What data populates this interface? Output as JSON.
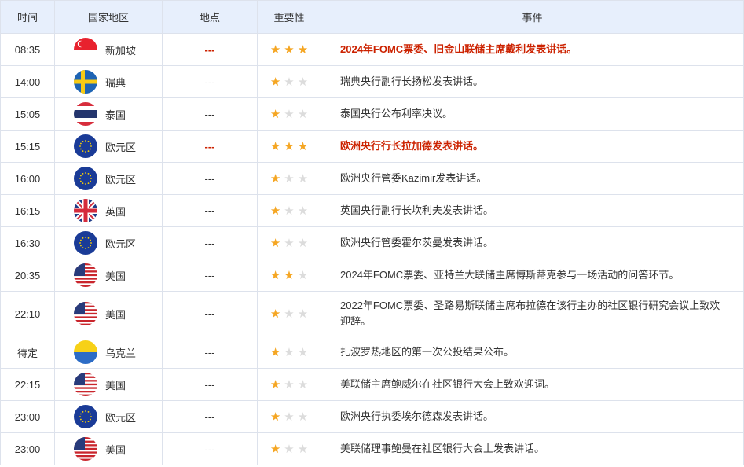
{
  "header": {
    "time": "时间",
    "country": "国家地区",
    "location": "地点",
    "importance": "重要性",
    "event": "事件"
  },
  "colors": {
    "high_importance_text": "#cc2200",
    "star_on": "#f5a623",
    "star_off": "#dcdcdc",
    "header_bg": "#e7effc"
  },
  "rows": [
    {
      "time": "08:35",
      "flag": "singapore-flag-icon",
      "country": "新加坡",
      "location": "---",
      "stars": 3,
      "event": "2024年FOMC票委、旧金山联储主席戴利发表讲话。"
    },
    {
      "time": "14:00",
      "flag": "sweden-flag-icon",
      "country": "瑞典",
      "location": "---",
      "stars": 1,
      "event": "瑞典央行副行长扬松发表讲话。"
    },
    {
      "time": "15:05",
      "flag": "thailand-flag-icon",
      "country": "泰国",
      "location": "---",
      "stars": 1,
      "event": "泰国央行公布利率决议。"
    },
    {
      "time": "15:15",
      "flag": "eu-flag-icon",
      "country": "欧元区",
      "location": "---",
      "stars": 3,
      "event": "欧洲央行行长拉加德发表讲话。"
    },
    {
      "time": "16:00",
      "flag": "eu-flag-icon",
      "country": "欧元区",
      "location": "---",
      "stars": 1,
      "event": "欧洲央行管委Kazimir发表讲话。"
    },
    {
      "time": "16:15",
      "flag": "uk-flag-icon",
      "country": "英国",
      "location": "---",
      "stars": 1,
      "event": "英国央行副行长坎利夫发表讲话。"
    },
    {
      "time": "16:30",
      "flag": "eu-flag-icon",
      "country": "欧元区",
      "location": "---",
      "stars": 1,
      "event": "欧洲央行管委霍尔茨曼发表讲话。"
    },
    {
      "time": "20:35",
      "flag": "usa-flag-icon",
      "country": "美国",
      "location": "---",
      "stars": 2,
      "event": "2024年FOMC票委、亚特兰大联储主席博斯蒂克参与一场活动的问答环节。"
    },
    {
      "time": "22:10",
      "flag": "usa-flag-icon",
      "country": "美国",
      "location": "---",
      "stars": 1,
      "event": "2022年FOMC票委、圣路易斯联储主席布拉德在该行主办的社区银行研究会议上致欢迎辞。"
    },
    {
      "time": "待定",
      "flag": "ukraine-flag-icon",
      "country": "乌克兰",
      "location": "---",
      "stars": 1,
      "event": "扎波罗热地区的第一次公投结果公布。"
    },
    {
      "time": "22:15",
      "flag": "usa-flag-icon",
      "country": "美国",
      "location": "---",
      "stars": 1,
      "event": "美联储主席鲍威尔在社区银行大会上致欢迎词。"
    },
    {
      "time": "23:00",
      "flag": "eu-flag-icon",
      "country": "欧元区",
      "location": "---",
      "stars": 1,
      "event": "欧洲央行执委埃尔德森发表讲话。"
    },
    {
      "time": "23:00",
      "flag": "usa-flag-icon",
      "country": "美国",
      "location": "---",
      "stars": 1,
      "event": "美联储理事鲍曼在社区银行大会上发表讲话。"
    }
  ]
}
